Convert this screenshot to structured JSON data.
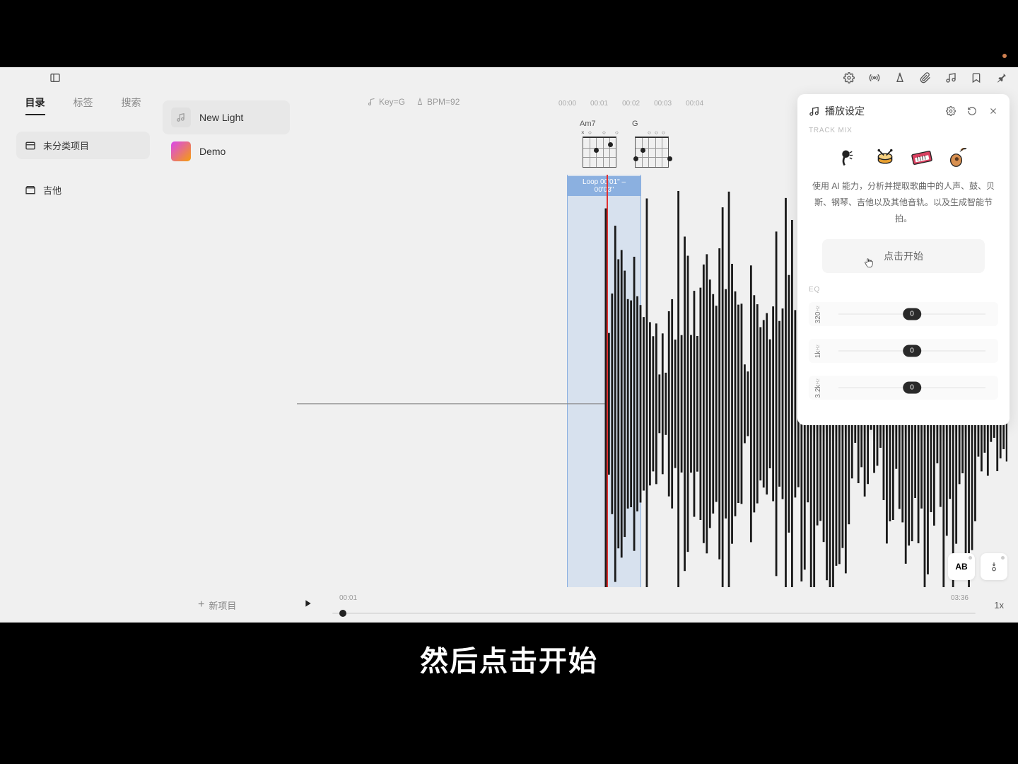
{
  "tabs": {
    "directory": "目录",
    "tags": "标签",
    "search": "搜索"
  },
  "sidebar": {
    "uncategorized": "未分类项目",
    "guitar": "吉他"
  },
  "songs": [
    {
      "name": "New Light"
    },
    {
      "name": "Demo"
    }
  ],
  "header": {
    "key": "Key=G",
    "bpm": "BPM=92"
  },
  "timeline": [
    "00:00",
    "00:01",
    "00:02",
    "00:03",
    "00:04"
  ],
  "chords": {
    "am7": "Am7",
    "g": "G"
  },
  "loop": {
    "label": "Loop 00'01\" – 00'03\""
  },
  "transport": {
    "current": "00:01",
    "total": "03:36",
    "speed": "1x",
    "newProject": "新项目"
  },
  "floatAB": "AB",
  "panel": {
    "title": "播放设定",
    "trackmix": "TRACK MIX",
    "desc": "使用 AI 能力，分析并提取歌曲中的人声、鼓、贝斯、钢琴、吉他以及其他音轨。以及生成智能节拍。",
    "start": "点击开始",
    "eq": "EQ",
    "bands": [
      {
        "freq": "320",
        "unit": "Hz",
        "value": "0"
      },
      {
        "freq": "1k",
        "unit": "Hz",
        "value": "0"
      },
      {
        "freq": "3.2k",
        "unit": "Hz",
        "value": "0"
      }
    ]
  },
  "subtitle": "然后点击开始"
}
